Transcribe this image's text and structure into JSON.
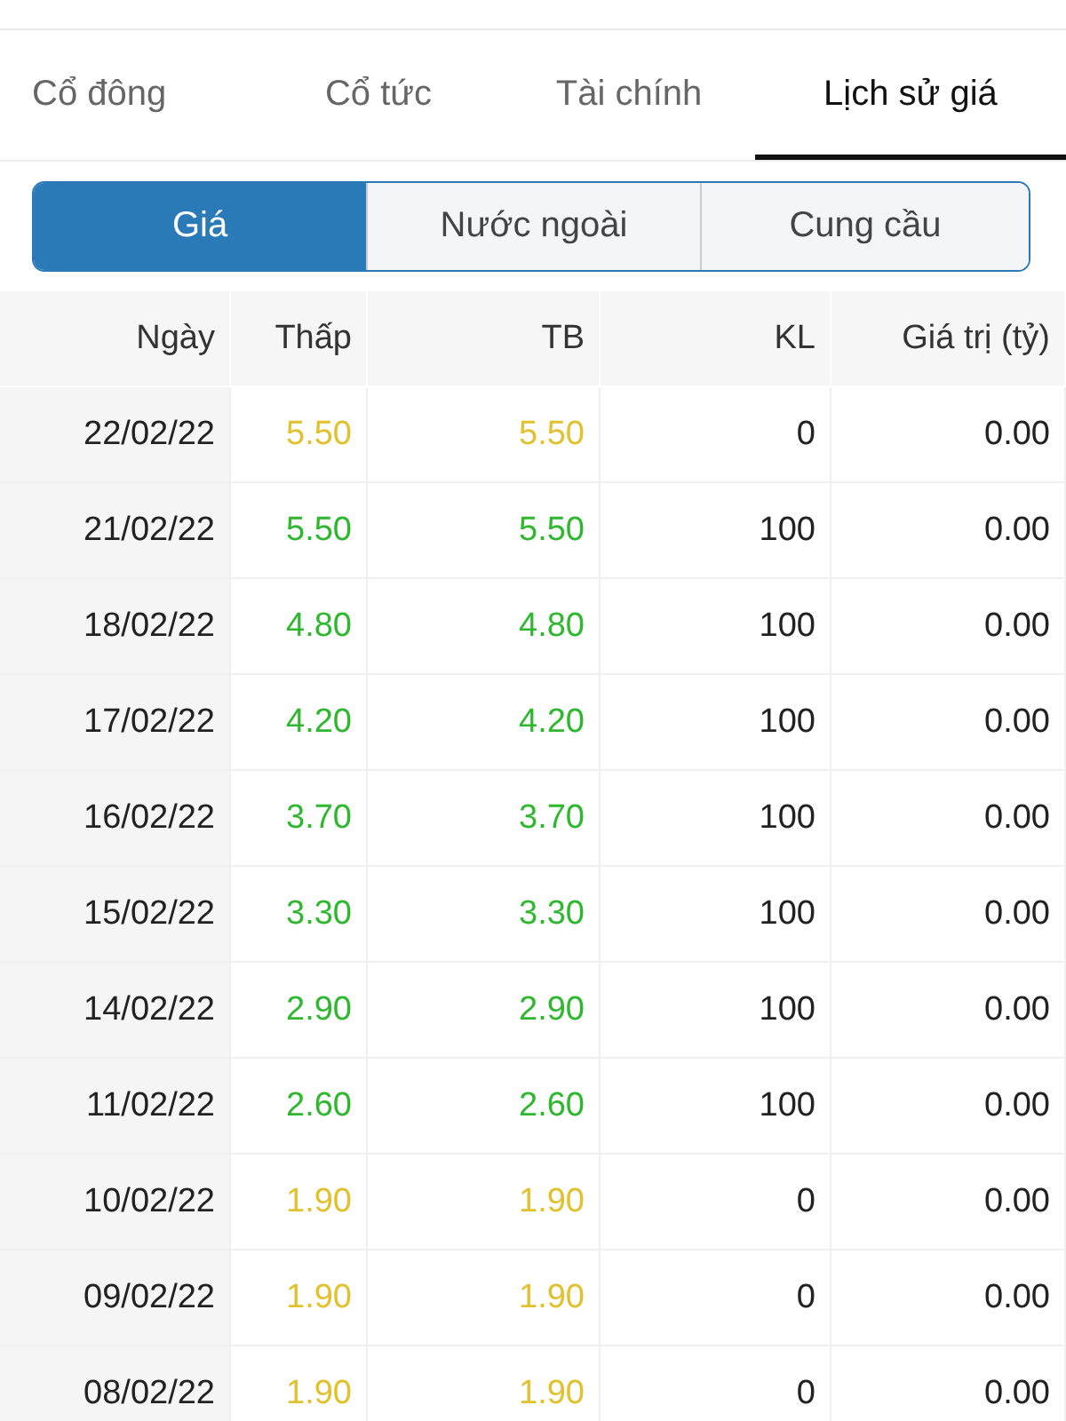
{
  "tabs": [
    {
      "label": "Cổ đông",
      "selected": false
    },
    {
      "label": "Cổ tức",
      "selected": false
    },
    {
      "label": "Tài chính",
      "selected": false
    },
    {
      "label": "Lịch sử giá",
      "selected": true
    }
  ],
  "segments": [
    {
      "label": "Giá",
      "selected": true
    },
    {
      "label": "Nước ngoài",
      "selected": false
    },
    {
      "label": "Cung cầu",
      "selected": false
    }
  ],
  "table": {
    "columns": [
      "Ngày",
      "Thấp",
      "TB",
      "KL",
      "Giá trị (tỷ)"
    ],
    "rows": [
      {
        "date": "22/02/22",
        "low": "5.50",
        "avg": "5.50",
        "volume": "0",
        "value": "0.00",
        "color": "#e2c12e"
      },
      {
        "date": "21/02/22",
        "low": "5.50",
        "avg": "5.50",
        "volume": "100",
        "value": "0.00",
        "color": "#2fb82f"
      },
      {
        "date": "18/02/22",
        "low": "4.80",
        "avg": "4.80",
        "volume": "100",
        "value": "0.00",
        "color": "#2fb82f"
      },
      {
        "date": "17/02/22",
        "low": "4.20",
        "avg": "4.20",
        "volume": "100",
        "value": "0.00",
        "color": "#2fb82f"
      },
      {
        "date": "16/02/22",
        "low": "3.70",
        "avg": "3.70",
        "volume": "100",
        "value": "0.00",
        "color": "#2fb82f"
      },
      {
        "date": "15/02/22",
        "low": "3.30",
        "avg": "3.30",
        "volume": "100",
        "value": "0.00",
        "color": "#2fb82f"
      },
      {
        "date": "14/02/22",
        "low": "2.90",
        "avg": "2.90",
        "volume": "100",
        "value": "0.00",
        "color": "#2fb82f"
      },
      {
        "date": "11/02/22",
        "low": "2.60",
        "avg": "2.60",
        "volume": "100",
        "value": "0.00",
        "color": "#2fb82f"
      },
      {
        "date": "10/02/22",
        "low": "1.90",
        "avg": "1.90",
        "volume": "0",
        "value": "0.00",
        "color": "#e2c12e"
      },
      {
        "date": "09/02/22",
        "low": "1.90",
        "avg": "1.90",
        "volume": "0",
        "value": "0.00",
        "color": "#e2c12e"
      },
      {
        "date": "08/02/22",
        "low": "1.90",
        "avg": "1.90",
        "volume": "0",
        "value": "0.00",
        "color": "#e2c12e"
      }
    ]
  }
}
